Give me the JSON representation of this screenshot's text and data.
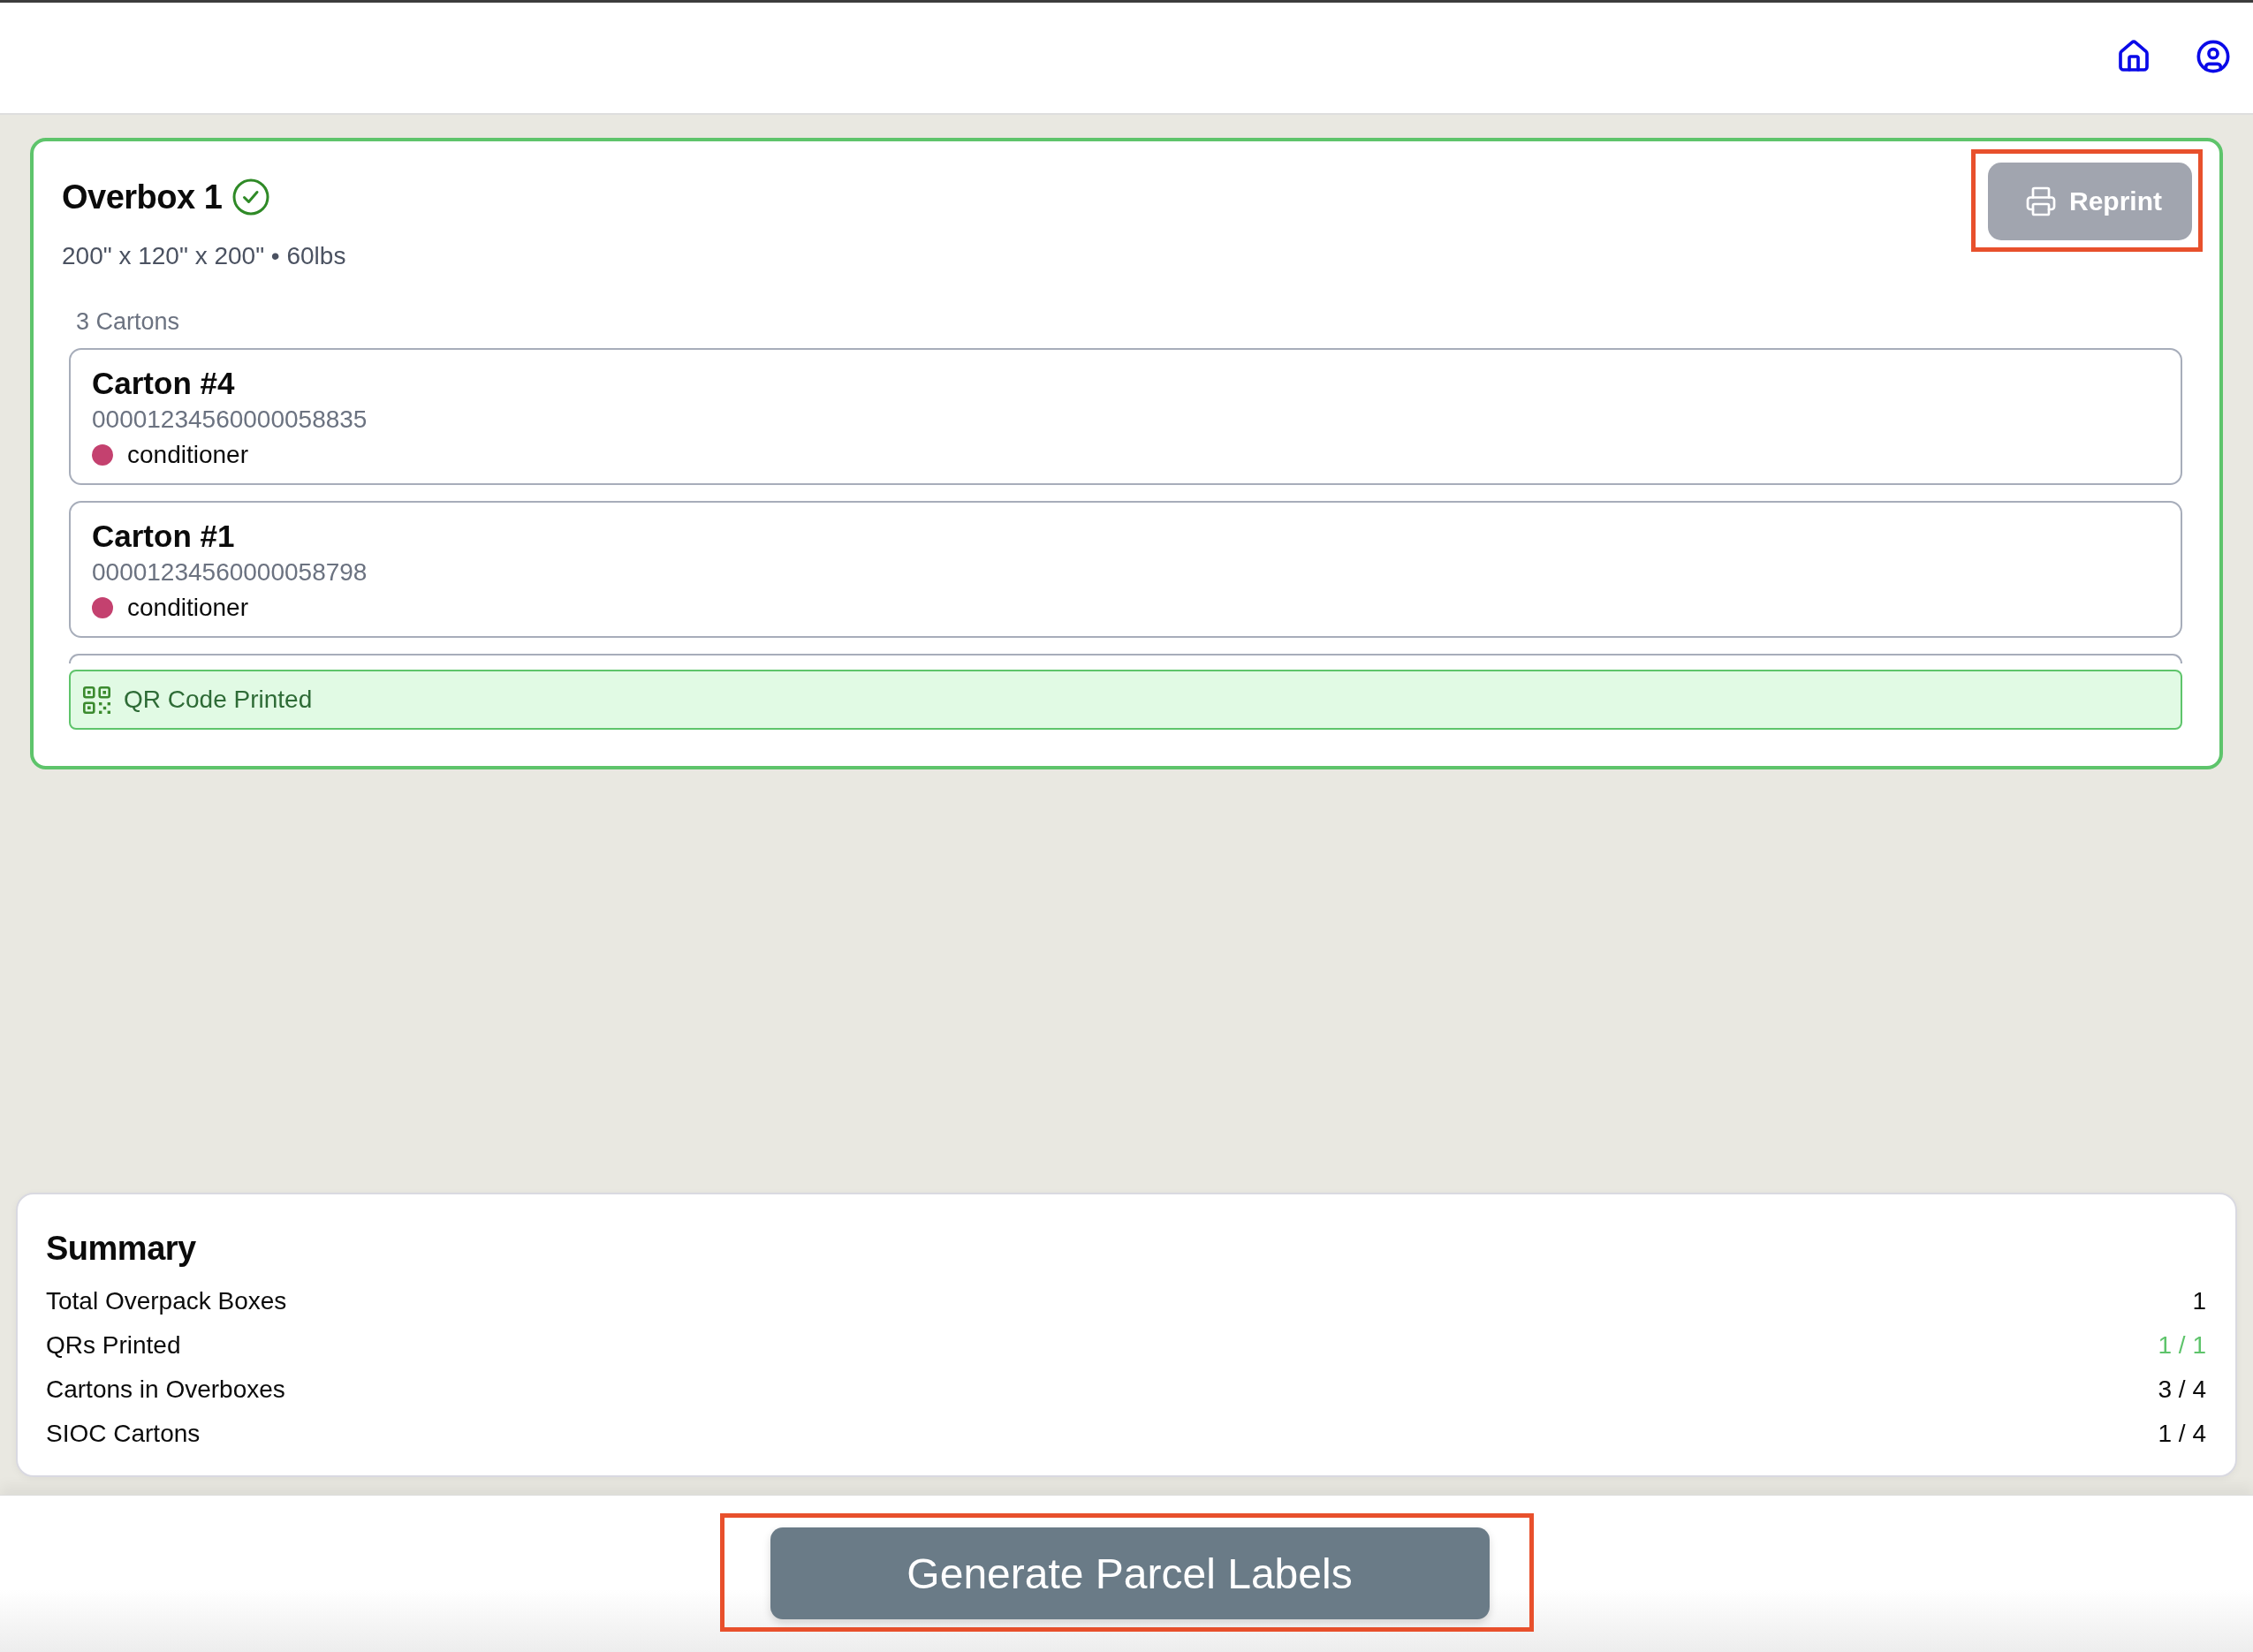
{
  "overbox": {
    "title": "Overbox 1",
    "verified": true,
    "details": "200\" x 120\" x 200\" • 60lbs",
    "reprint_button": {
      "label": "Reprint",
      "highlighted": true
    },
    "carton_count": "3 Cartons",
    "cartons": [
      {
        "title": "Carton #4",
        "code": "00001234560000058835",
        "product": "conditioner",
        "color": "#c4416f"
      },
      {
        "title": "Carton #1",
        "code": "00001234560000058798",
        "product": "conditioner",
        "color": "#c4416f"
      }
    ],
    "more_cartons_below": true,
    "qr_status": {
      "label": "QR Code Printed",
      "printed": true
    }
  },
  "summary": {
    "title": "Summary",
    "rows": [
      {
        "label": "Total Overpack Boxes",
        "value": "1",
        "complete": false
      },
      {
        "label": "QRs Printed",
        "value": "1 / 1",
        "complete": true
      },
      {
        "label": "Cartons in Overboxes",
        "value": "3 / 4",
        "complete": false
      },
      {
        "label": "SIOC Cartons",
        "value": "1 / 4",
        "complete": false
      }
    ]
  },
  "generate_button": {
    "label": "Generate Parcel Labels",
    "highlighted": true
  }
}
